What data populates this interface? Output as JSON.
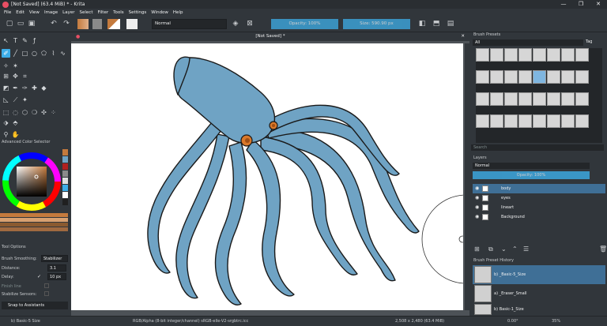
{
  "window": {
    "title": "[Not Saved]  (63.4 MiB)  * - Krita",
    "controls": [
      "—",
      "❐",
      "✕"
    ]
  },
  "menu": [
    "File",
    "Edit",
    "View",
    "Image",
    "Layer",
    "Select",
    "Filter",
    "Tools",
    "Settings",
    "Window",
    "Help"
  ],
  "toolbar": {
    "blend_mode": "Normal",
    "opacity_label": "Opacity: 100%",
    "size_label": "Size: 590.90 px",
    "fg_color": "#c47a3d",
    "bg_color": "#8a8a8a"
  },
  "canvas": {
    "tab_title": "[Not Saved]  *",
    "close": "✕"
  },
  "docker": {
    "color_selector_title": "Advanced Color Selector",
    "tool_options_title": "Tool Options",
    "brush_smoothing_label": "Brush Smoothing:",
    "brush_smoothing_value": "Stabilizer",
    "distance_label": "Distance:",
    "distance_value": "3.1",
    "delay_label": "Delay:",
    "delay_value": "10 px",
    "finish_line_label": "Finish line",
    "stabilize_sensors_label": "Stabilize Sensors:",
    "snap_label": "Snap to Assistants"
  },
  "presets": {
    "title": "Brush Presets",
    "filter": "All",
    "tag_label": "Tag",
    "search_placeholder": "Search"
  },
  "layers": {
    "title": "Layers",
    "blend": "Normal",
    "opacity": "Opacity:  100%",
    "items": [
      {
        "name": "body",
        "selected": true
      },
      {
        "name": "eyes",
        "selected": false
      },
      {
        "name": "lineart",
        "selected": false
      },
      {
        "name": "Background",
        "selected": false
      }
    ]
  },
  "history": {
    "title": "Brush Preset History",
    "items": [
      {
        "name": "b) _Basic-5_Size",
        "selected": true
      },
      {
        "name": "a) _Eraser_Small",
        "selected": false
      },
      {
        "name": "b) Basic-1_Size",
        "selected": false
      }
    ]
  },
  "status": {
    "brush": "b) Basic-5 Size",
    "colorspace": "RGB/Alpha (8-bit integer/channel)  sRGB-elle-V2-srgbtrc.icc",
    "dims": "2,508 x 2,480 (63.4 MiB)",
    "angle": "0.00°",
    "zoom": "35%"
  },
  "colors": {
    "squid": "#6fa3c4",
    "eye": "#d9782a",
    "accent": "#3daee9"
  }
}
